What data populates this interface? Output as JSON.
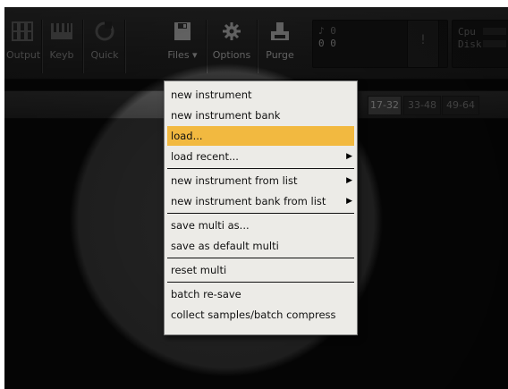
{
  "toolbar": {
    "output_label": "Output",
    "keyb_label": "Keyb",
    "quick_label": "Quick",
    "files_label": "Files",
    "options_label": "Options",
    "purge_label": "Purge",
    "voices_icon_text": "♪ 0",
    "voices_count": "0 0",
    "alert_symbol": "!",
    "cpu_label": "Cpu",
    "disk_label": "Disk"
  },
  "page_tabs": [
    "17-32",
    "33-48",
    "49-64"
  ],
  "files_menu": {
    "items": [
      {
        "label": "new instrument",
        "submenu": false
      },
      {
        "label": "new instrument bank",
        "submenu": false
      },
      {
        "label": "load...",
        "submenu": false
      },
      {
        "label": "load recent...",
        "submenu": true
      },
      {
        "label": "new instrument from list",
        "submenu": true
      },
      {
        "label": "new instrument bank from list",
        "submenu": true
      },
      {
        "label": "save multi as...",
        "submenu": false
      },
      {
        "label": "save as default multi",
        "submenu": false
      },
      {
        "label": "reset multi",
        "submenu": false
      },
      {
        "label": "batch re-save",
        "submenu": false
      },
      {
        "label": "collect samples/batch compress",
        "submenu": false
      }
    ],
    "highlighted_index": 2
  },
  "colors": {
    "menu_background": "#ecebe7",
    "highlight": "#f2b940",
    "app_background": "#0b0b0b"
  }
}
